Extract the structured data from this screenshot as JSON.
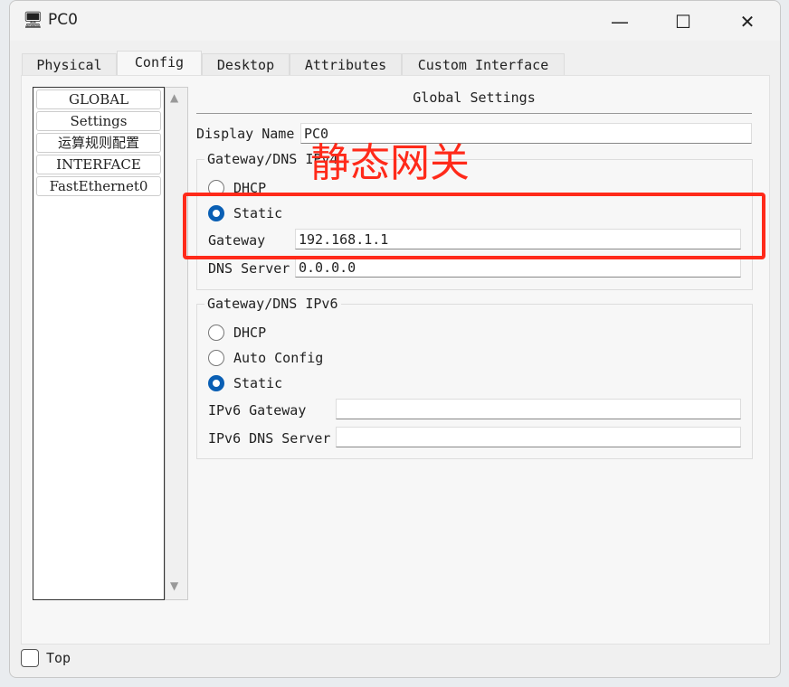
{
  "window": {
    "title": "PC0",
    "minimize": "—",
    "maximize": "☐",
    "close": "✕",
    "icon": "pc-icon"
  },
  "tabs": [
    "Physical",
    "Config",
    "Desktop",
    "Attributes",
    "Custom Interface"
  ],
  "active_tab": "Config",
  "sidebar": {
    "items": [
      "GLOBAL",
      "Settings",
      "运算规则配置",
      "INTERFACE",
      "FastEthernet0"
    ]
  },
  "global": {
    "heading": "Global Settings",
    "display_name_label": "Display Name",
    "display_name": "PC0",
    "ipv4": {
      "legend": "Gateway/DNS IPv4",
      "dhcp": "DHCP",
      "static": "Static",
      "selected": "Static",
      "gateway_label": "Gateway",
      "gateway": "192.168.1.1",
      "dns_label": "DNS Server",
      "dns": "0.0.0.0"
    },
    "ipv6": {
      "legend": "Gateway/DNS IPv6",
      "dhcp": "DHCP",
      "auto": "Auto Config",
      "static": "Static",
      "selected": "Static",
      "gateway_label": "IPv6 Gateway",
      "gateway": "",
      "dns_label": "IPv6 DNS Server",
      "dns": ""
    }
  },
  "annotation": {
    "text": "静态网关",
    "color": "#ff2a1a"
  },
  "footer": {
    "top_label": "Top",
    "top_checked": false
  }
}
